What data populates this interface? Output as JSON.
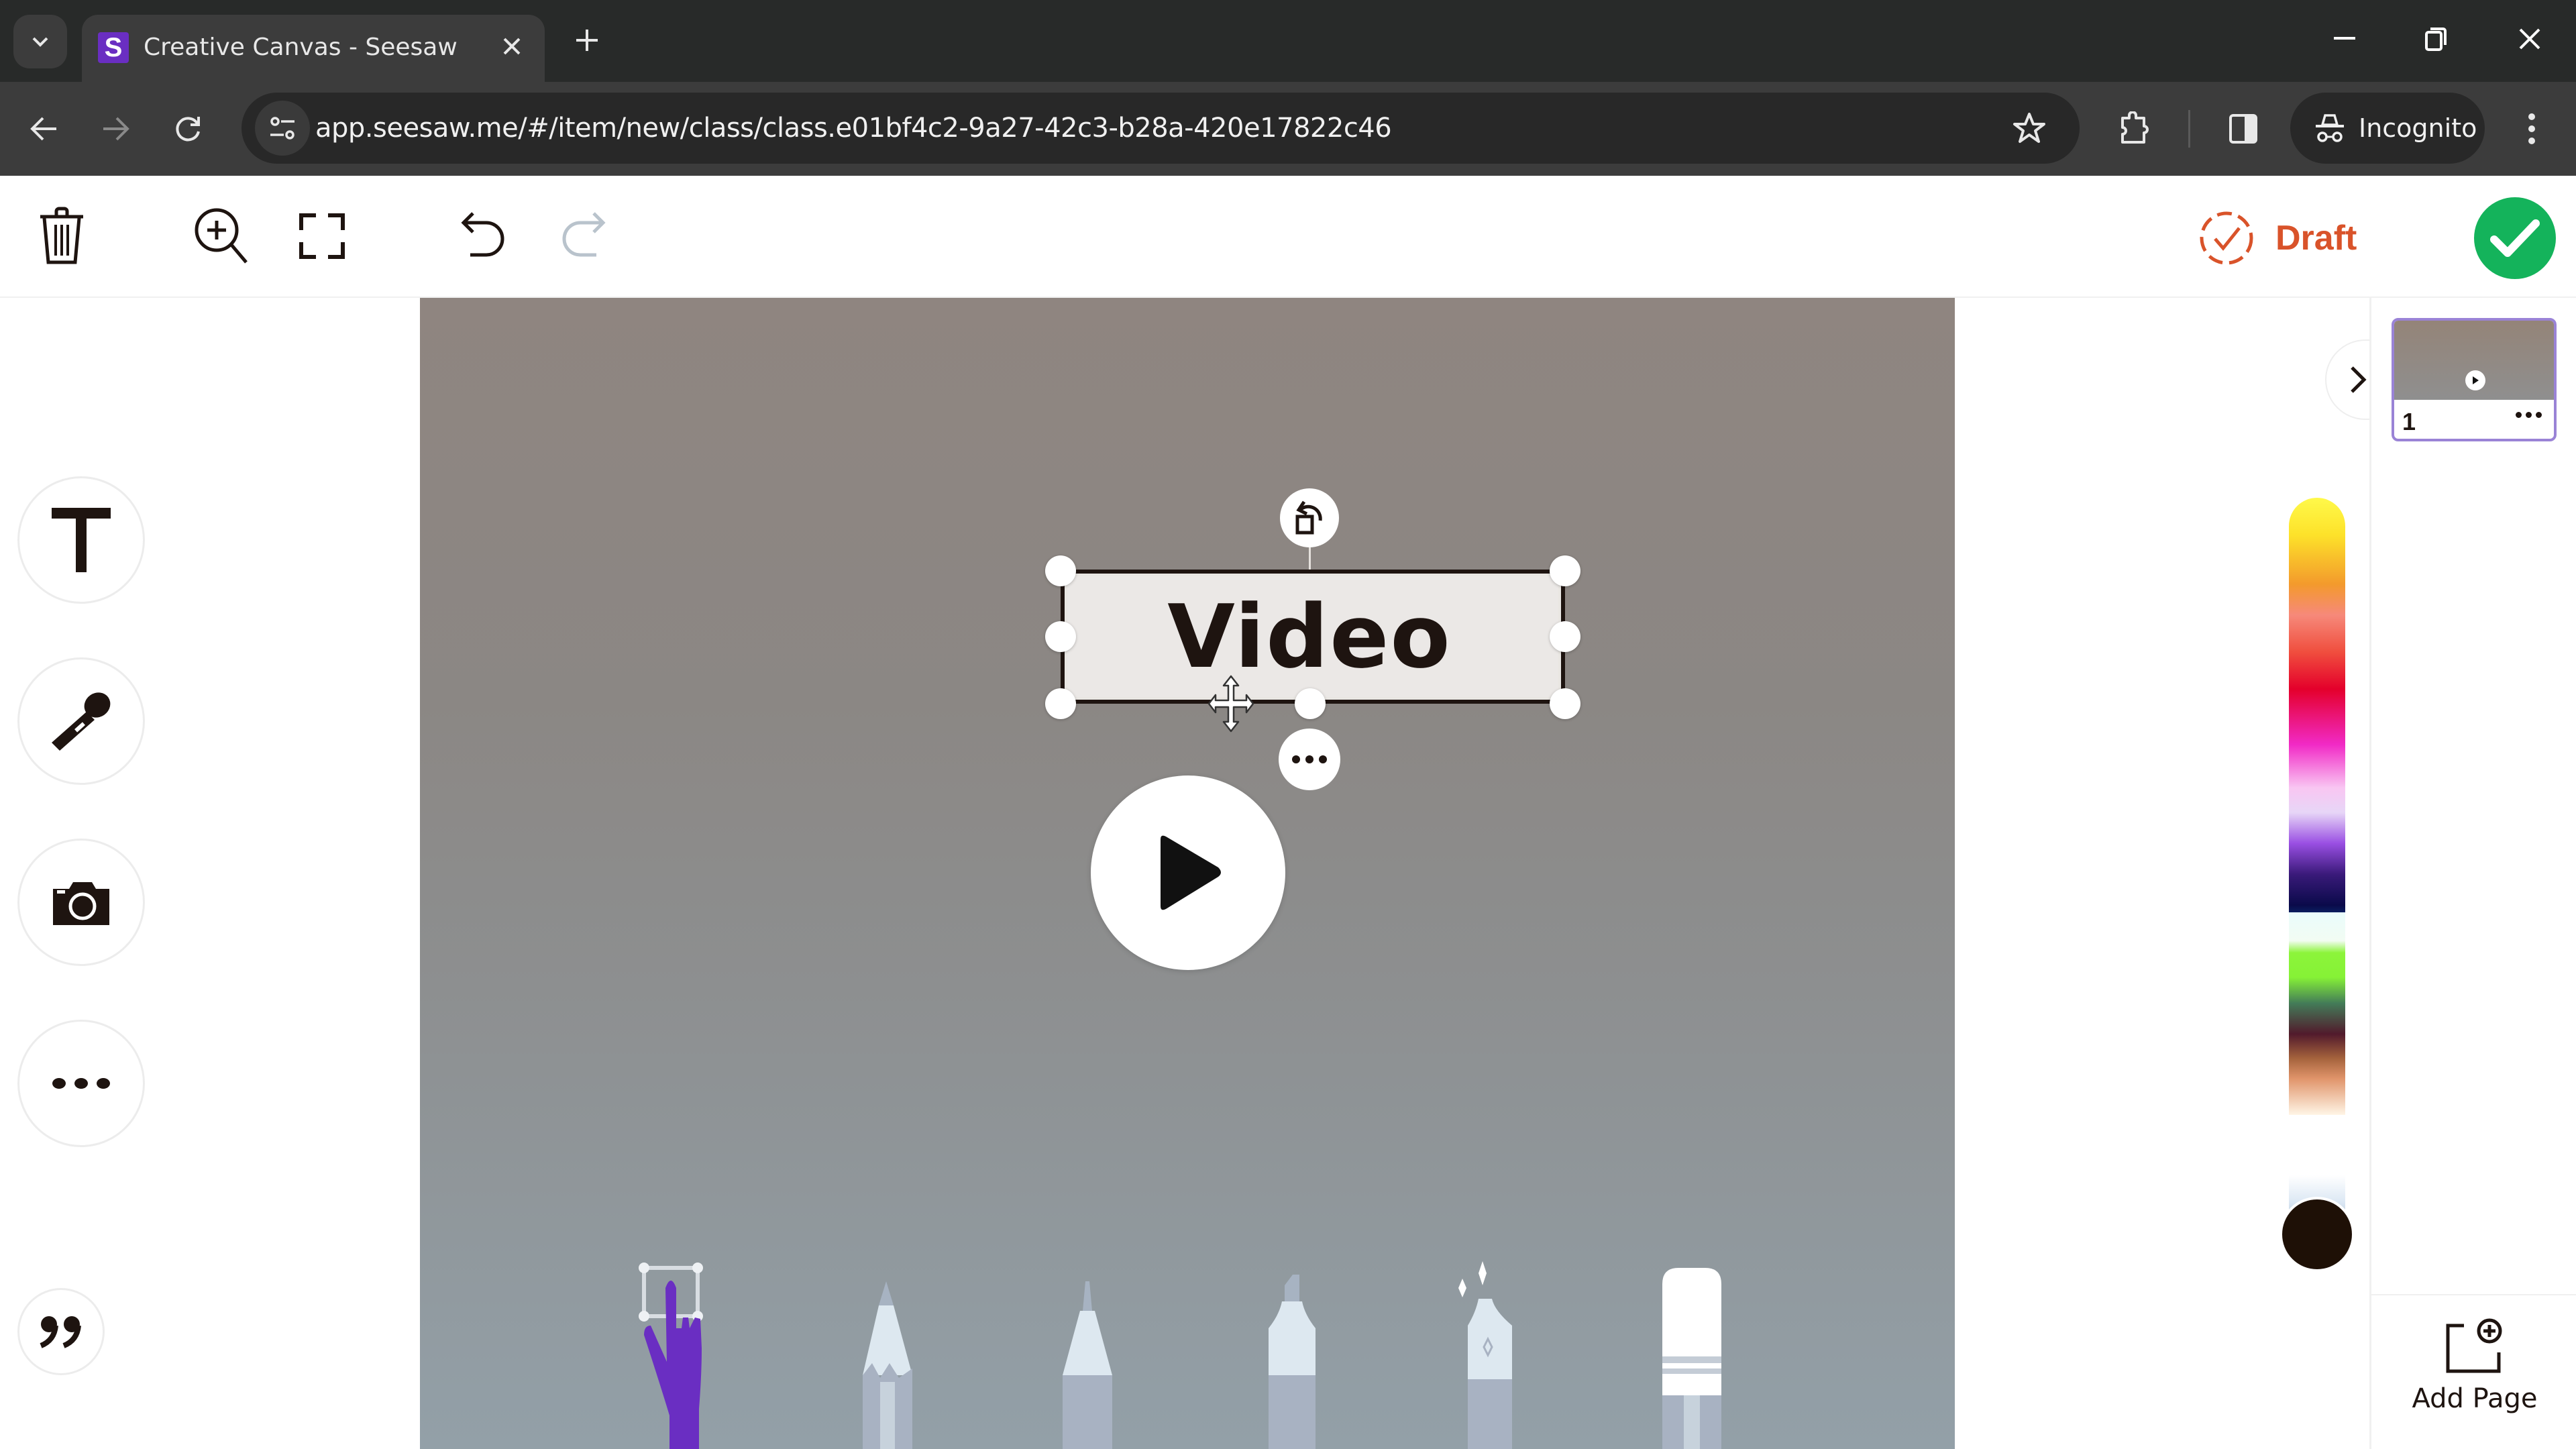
{
  "browser": {
    "tab": {
      "title": "Creative Canvas - Seesaw",
      "favicon_letter": "S",
      "favicon_color": "#6a2ec2"
    },
    "url": "app.seesaw.me/#/item/new/class/class.e01bf4c2-9a27-42c3-b28a-420e17822c46",
    "profile_label": "Incognito",
    "icons": {
      "tab_dropdown": "chevron-down-icon",
      "tab_close": "close-icon",
      "new_tab": "plus-icon",
      "minimize": "minimize-icon",
      "restore": "restore-icon",
      "close_window": "close-icon",
      "back": "arrow-left-icon",
      "forward": "arrow-right-icon",
      "reload": "reload-icon",
      "site_info": "tune-icon",
      "bookmark": "star-icon",
      "extensions": "puzzle-icon",
      "side_panel": "side-panel-icon",
      "incognito": "incognito-icon",
      "menu": "kebab-menu-icon"
    }
  },
  "app_toolbar": {
    "tools": [
      {
        "id": "delete",
        "icon": "trash-icon"
      },
      {
        "id": "zoom",
        "icon": "zoom-in-icon"
      },
      {
        "id": "fullscreen",
        "icon": "fullscreen-icon"
      },
      {
        "id": "undo",
        "icon": "undo-icon",
        "enabled": true
      },
      {
        "id": "redo",
        "icon": "redo-icon",
        "enabled": false
      }
    ],
    "status": {
      "label": "Draft",
      "color": "#d9532a",
      "icon": "dashed-check-circle-icon"
    },
    "submit": {
      "icon": "check-icon",
      "color": "#14b35b"
    }
  },
  "left_rail": {
    "tools": [
      {
        "id": "text",
        "icon": "text-icon",
        "glyph": "T"
      },
      {
        "id": "audio",
        "icon": "microphone-icon"
      },
      {
        "id": "camera",
        "icon": "camera-icon"
      },
      {
        "id": "more",
        "icon": "more-horizontal-icon"
      },
      {
        "id": "quote",
        "icon": "quote-icon",
        "glyph": "”"
      }
    ]
  },
  "canvas": {
    "text_object": {
      "text": "Video",
      "selected": true
    },
    "controls": {
      "rotate": "rotate-icon",
      "more": "more-horizontal-icon"
    },
    "media": {
      "type": "video",
      "icon": "play-icon"
    },
    "drawing_tools": [
      {
        "id": "hand",
        "icon": "hand-pointer-icon",
        "active": true,
        "color": "#6a2ec2"
      },
      {
        "id": "pencil",
        "icon": "pencil-icon"
      },
      {
        "id": "marker",
        "icon": "marker-icon"
      },
      {
        "id": "highlighter",
        "icon": "highlighter-icon"
      },
      {
        "id": "glitter",
        "icon": "glitter-pen-icon"
      },
      {
        "id": "eraser",
        "icon": "eraser-icon"
      }
    ]
  },
  "palette": {
    "selected_color": "#1e1006"
  },
  "pages": {
    "items": [
      {
        "number": "1",
        "thumbnail": "video-page-thumbnail"
      }
    ],
    "add_page_label": "Add Page",
    "collapse_icon": "chevron-right-icon"
  }
}
